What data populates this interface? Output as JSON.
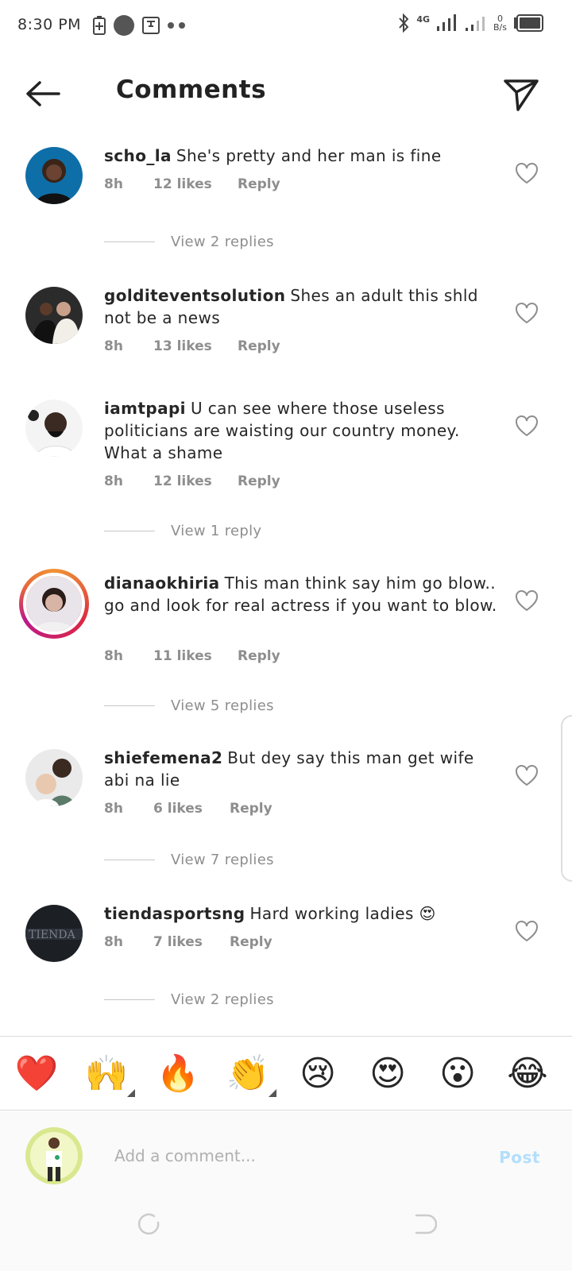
{
  "status": {
    "time": "8:30 PM",
    "network": "4G",
    "speed_value": "0",
    "speed_unit": "B/s"
  },
  "header": {
    "title": "Comments"
  },
  "comments": [
    {
      "username": "scho_la",
      "text": "She's pretty and her man is fine",
      "time": "8h",
      "likes": "12 likes",
      "reply": "Reply",
      "view_replies": "View 2 replies"
    },
    {
      "username": "golditeventsolution",
      "text": "Shes an adult this shld not be a news",
      "time": "8h",
      "likes": "13 likes",
      "reply": "Reply"
    },
    {
      "username": "iamtpapi",
      "text": "U can see where those useless politicians are waisting our country money. What a shame",
      "time": "8h",
      "likes": "12 likes",
      "reply": "Reply",
      "view_replies": "View 1 reply"
    },
    {
      "username": "dianaokhiria",
      "text": "This man think say him go blow.. go and look for real actress if you want to blow.",
      "time": "8h",
      "likes": "11 likes",
      "reply": "Reply",
      "view_replies": "View 5 replies"
    },
    {
      "username": "shiefemena2",
      "text": "But dey say this man get wife abi na lie",
      "time": "8h",
      "likes": "6 likes",
      "reply": "Reply",
      "view_replies": "View 7 replies"
    },
    {
      "username": "tiendasportsng",
      "text": "Hard working ladies 😍",
      "time": "8h",
      "likes": "7 likes",
      "reply": "Reply",
      "view_replies": "View 2 replies"
    }
  ],
  "emoji_bar": [
    "❤️",
    "🙌",
    "🔥",
    "👏",
    "😢",
    "😍",
    "😮",
    "😂"
  ],
  "composer": {
    "placeholder": "Add a comment...",
    "post_label": "Post"
  },
  "colors": {
    "text": "#262626",
    "muted": "#8e8e8e",
    "post_disabled": "#b2dffc"
  }
}
